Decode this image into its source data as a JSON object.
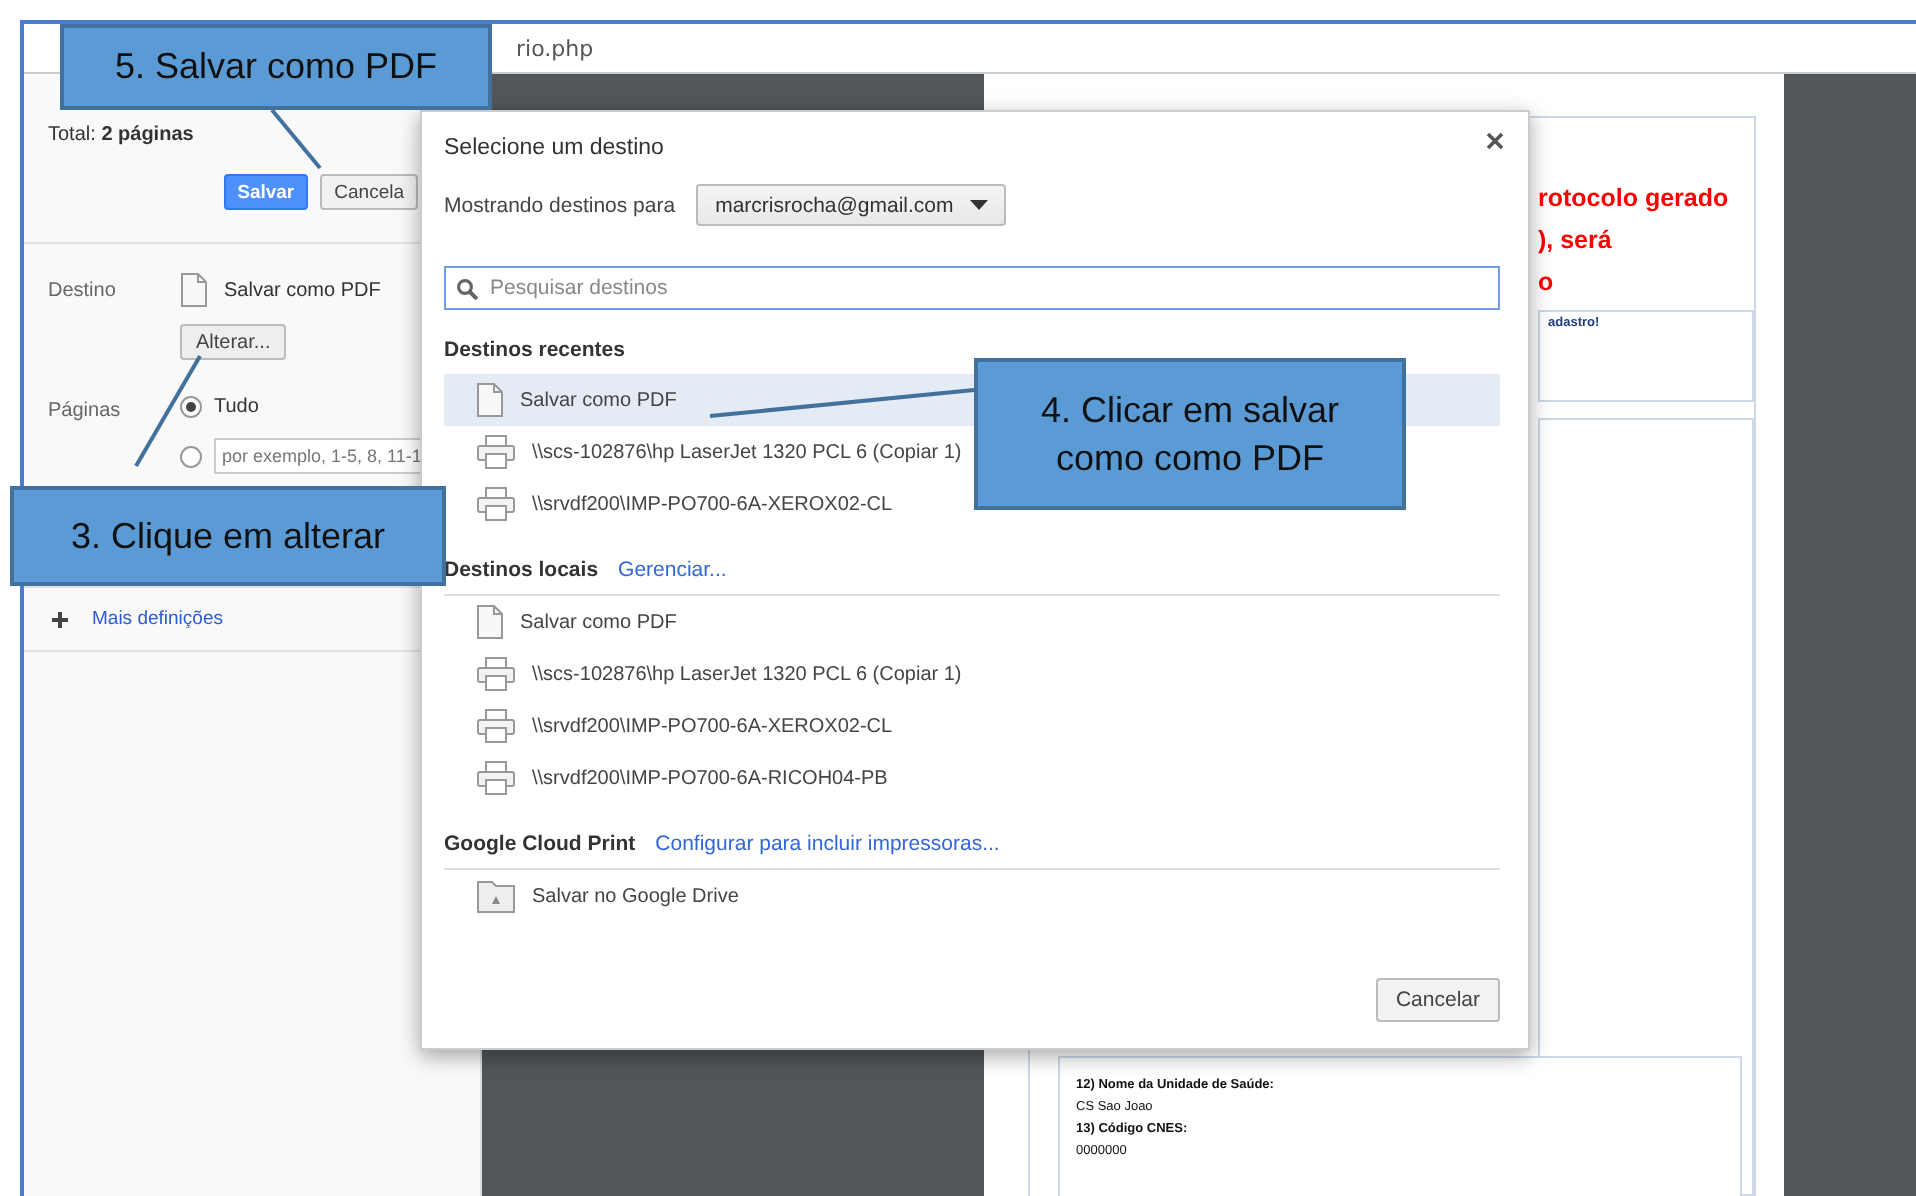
{
  "browser": {
    "address": "rio.php"
  },
  "print_panel": {
    "total": "Total: **2 páginas**",
    "buttons": [
      {
        "label": "Salvar",
        "kind": "primary"
      },
      {
        "label": "Cancela",
        "kind": "secondary"
      }
    ],
    "destination": {
      "label": "Destino",
      "value": "Salvar como PDF",
      "change_button": "Alterar..."
    },
    "pages": {
      "label": "Páginas",
      "options": [
        {
          "kind": "text",
          "label": "Tudo",
          "selected": true
        },
        {
          "kind": "input",
          "placeholder": "por exemplo, 1-5, 8, 11-1",
          "selected": false
        }
      ]
    },
    "more_settings": "Mais definições"
  },
  "dialog": {
    "title": "Selecione um destino",
    "account_label": "Mostrando destinos para",
    "account": "marcrisrocha@gmail.com",
    "search_placeholder": "Pesquisar destinos",
    "sections": [
      {
        "title": "Destinos recentes",
        "items": [
          {
            "kind": "pdf",
            "label": "Salvar como PDF",
            "selected": true
          },
          {
            "kind": "printer",
            "label": "\\\\scs-102876\\hp LaserJet 1320 PCL 6 (Copiar 1)",
            "selected": false
          },
          {
            "kind": "printer",
            "label": "\\\\srvdf200\\IMP-PO700-6A-XEROX02-CL",
            "selected": false
          }
        ]
      },
      {
        "title": "Destinos locais",
        "link": "Gerenciar...",
        "items": [
          {
            "kind": "pdf",
            "label": "Salvar como PDF",
            "selected": false
          },
          {
            "kind": "printer",
            "label": "\\\\scs-102876\\hp LaserJet 1320 PCL 6 (Copiar 1)",
            "selected": false
          },
          {
            "kind": "printer",
            "label": "\\\\srvdf200\\IMP-PO700-6A-XEROX02-CL",
            "selected": false
          },
          {
            "kind": "printer",
            "label": "\\\\srvdf200\\IMP-PO700-6A-RICOH04-PB",
            "selected": false
          }
        ]
      },
      {
        "title": "Google Cloud Print",
        "link": "Configurar para incluir impressoras...",
        "items": [
          {
            "kind": "drive",
            "label": "Salvar no Google Drive",
            "selected": false
          }
        ]
      }
    ],
    "cancel": "Cancelar"
  },
  "preview": {
    "notice_lines": [
      "rotocolo gerado",
      "), será",
      "o"
    ],
    "small_note": "adastro!",
    "fields": [
      {
        "label": "12) Nome da Unidade de Saúde:",
        "value": "CS Sao Joao"
      },
      {
        "label": "13) Código CNES:",
        "value": "0000000"
      }
    ]
  },
  "callouts": [
    {
      "text": "5. Salvar como PDF"
    },
    {
      "text": "3. Clique em alterar"
    },
    {
      "text": "4. Clicar em salvar como como PDF"
    }
  ]
}
